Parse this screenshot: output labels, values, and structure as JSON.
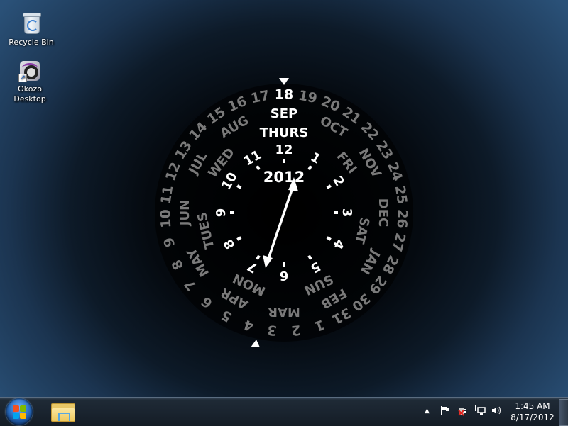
{
  "desktop": {
    "icons": [
      {
        "label": "Recycle Bin",
        "icon": "recycle-bin-icon"
      },
      {
        "label": "Okozo Desktop",
        "label_lines": [
          "Okozo",
          "Desktop"
        ],
        "icon": "okozo-icon"
      }
    ]
  },
  "clock_widget": {
    "selected": {
      "day": "18",
      "month": "SEP",
      "weekday": "THURS",
      "year": "2012"
    },
    "days": [
      "1",
      "2",
      "3",
      "4",
      "5",
      "6",
      "7",
      "8",
      "9",
      "10",
      "11",
      "12",
      "13",
      "14",
      "15",
      "16",
      "17",
      "18",
      "19",
      "20",
      "21",
      "22",
      "23",
      "24",
      "25",
      "26",
      "27",
      "28",
      "29",
      "30",
      "31"
    ],
    "months": [
      "JAN",
      "FEB",
      "MAR",
      "APR",
      "MAY",
      "JUN",
      "JUL",
      "AUG",
      "SEP",
      "OCT",
      "NOV",
      "DEC"
    ],
    "weekdays": [
      "MON",
      "TUES",
      "WED",
      "THURS",
      "FRI",
      "SAT",
      "SUN"
    ],
    "hours": [
      "12",
      "1",
      "2",
      "3",
      "4",
      "5",
      "6",
      "7",
      "8",
      "9",
      "10",
      "11"
    ],
    "year": "2012",
    "colors": {
      "active": "#ffffff",
      "inactive": "#7a7a7a",
      "face": "#000000"
    }
  },
  "taskbar": {
    "start_button": "windows-start-icon",
    "pinned": [
      {
        "name": "Windows Explorer",
        "icon": "folder-icon"
      }
    ],
    "tray": {
      "icons": [
        "show-hidden-icons-arrow",
        "action-center-flag-icon",
        "power-icon",
        "network-icon",
        "volume-icon"
      ],
      "time": "1:45 AM",
      "date": "8/17/2012"
    }
  }
}
